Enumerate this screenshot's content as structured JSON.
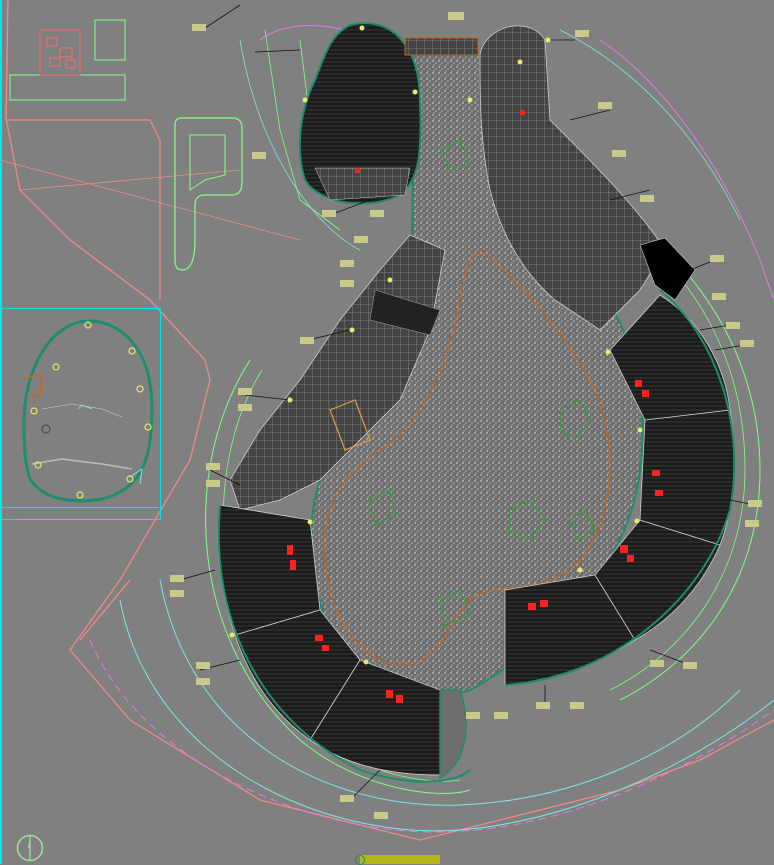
{
  "app": {
    "kind": "cad-site-plan-viewport"
  },
  "colors": {
    "background": "#808080",
    "building_fill": "#1e1e1e",
    "gravel_fill": "#707070",
    "site_boundary": "#f08a8a",
    "setback_line": "#7fe5e5",
    "road_line": "#7fff7f",
    "magenta_line": "#e07be0",
    "path_orange": "#c8641e",
    "seating_red": "#ff2020",
    "facade_teal": "#1e8c6e",
    "north_arrow": "#9fdf9f",
    "title_block": "#b5b51a",
    "keymap_frame": "#00e5e5"
  },
  "layers": [
    "site-boundary",
    "setback",
    "roads",
    "buildings",
    "landscape",
    "annotations",
    "key-map"
  ],
  "icons": {
    "north_arrow": "north-arrow-icon",
    "keymap": "key-map-icon"
  }
}
